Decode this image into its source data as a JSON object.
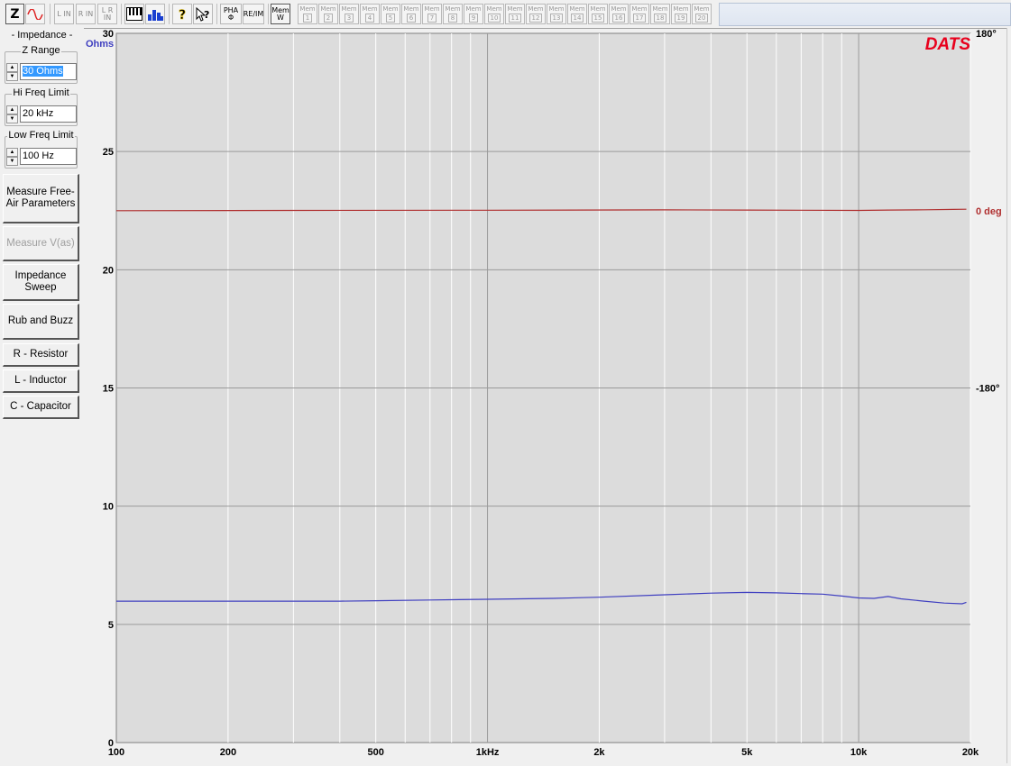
{
  "toolbar": {
    "buttons": [
      {
        "label": "Z"
      },
      {
        "label": "L IN"
      },
      {
        "label": "R IN"
      },
      {
        "label": "L R IN"
      },
      {
        "label": "PHA Φ"
      },
      {
        "label": "RE/IM"
      },
      {
        "label": "Mem W"
      }
    ],
    "mem_label": "Mem",
    "mem_slots": [
      "1",
      "2",
      "3",
      "4",
      "5",
      "6",
      "7",
      "8",
      "9",
      "10",
      "11",
      "12",
      "13",
      "14",
      "15",
      "16",
      "17",
      "18",
      "19",
      "20"
    ]
  },
  "panel": {
    "title": "- Impedance -",
    "z_range": {
      "legend": "Z Range",
      "value": "30 Ohms"
    },
    "hi_freq": {
      "legend": "Hi Freq Limit",
      "value": "20 kHz"
    },
    "low_freq": {
      "legend": "Low Freq Limit",
      "value": "100 Hz"
    },
    "buttons": {
      "measure_free_air": "Measure Free-Air Parameters",
      "measure_vas": "Measure V(as)",
      "impedance_sweep": "Impedance Sweep",
      "rub_buzz": "Rub and Buzz",
      "resistor": "R - Resistor",
      "inductor": "L - Inductor",
      "capacitor": "C - Capacitor"
    }
  },
  "colors": {
    "impedance": "#3f3fc0",
    "phase": "#b03030",
    "plot_bg": "#dcdcdc",
    "grid": "#ffffff",
    "brand": "#e8001c"
  },
  "chart_data": {
    "type": "line",
    "brand": "DATS",
    "x_scale": "log",
    "xlim": [
      100,
      20000
    ],
    "x_ticks": [
      {
        "v": 100,
        "label": "100"
      },
      {
        "v": 200,
        "label": "200"
      },
      {
        "v": 500,
        "label": "500"
      },
      {
        "v": 1000,
        "label": "1kHz"
      },
      {
        "v": 2000,
        "label": "2k"
      },
      {
        "v": 5000,
        "label": "5k"
      },
      {
        "v": 10000,
        "label": "10k"
      },
      {
        "v": 20000,
        "label": "20k"
      }
    ],
    "y_left": {
      "label": "Ohms",
      "lim": [
        0,
        30
      ],
      "ticks": [
        "0",
        "5",
        "10",
        "15",
        "20",
        "25",
        "30"
      ]
    },
    "y_right": {
      "lim": [
        -540,
        180
      ],
      "ticks": [
        {
          "v": 180,
          "label": "180°"
        },
        {
          "v": 0,
          "label": "0 deg"
        },
        {
          "v": -180,
          "label": "-180°"
        }
      ]
    },
    "grid": true,
    "series": [
      {
        "key": "impedance",
        "axis": "left",
        "x": [
          100,
          200,
          300,
          400,
          500,
          700,
          1000,
          1500,
          2000,
          3000,
          4000,
          5000,
          6000,
          7000,
          8000,
          9000,
          10000,
          11000,
          12000,
          13000,
          15000,
          17000,
          19000,
          19500
        ],
        "y": [
          5.98,
          5.98,
          5.98,
          5.98,
          6.0,
          6.03,
          6.06,
          6.1,
          6.15,
          6.25,
          6.32,
          6.35,
          6.33,
          6.3,
          6.28,
          6.2,
          6.12,
          6.1,
          6.18,
          6.08,
          5.98,
          5.9,
          5.87,
          5.93
        ]
      },
      {
        "key": "phase",
        "axis": "right",
        "x": [
          100,
          300,
          1000,
          3000,
          5000,
          10000,
          12000,
          15000,
          18000,
          19500
        ],
        "y": [
          0,
          0.2,
          0.4,
          0.8,
          0.6,
          0.2,
          0.6,
          0.9,
          1.2,
          1.4
        ]
      }
    ]
  }
}
